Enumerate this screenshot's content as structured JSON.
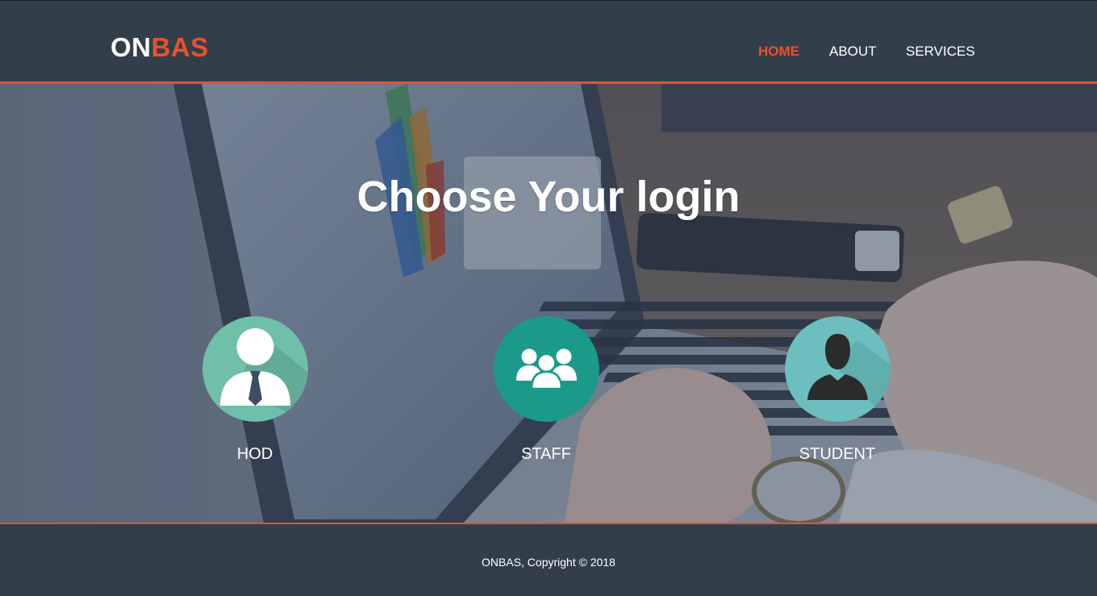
{
  "brand": {
    "part_a": "ON",
    "part_b": "BAS"
  },
  "nav": {
    "items": [
      {
        "label": "HOME",
        "active": true
      },
      {
        "label": "ABOUT",
        "active": false
      },
      {
        "label": "SERVICES",
        "active": false
      }
    ]
  },
  "hero": {
    "title": "Choose Your login",
    "roles": [
      {
        "label": "HOD",
        "icon": "hod-user-tie-icon"
      },
      {
        "label": "STAFF",
        "icon": "staff-group-icon"
      },
      {
        "label": "STUDENT",
        "icon": "student-silhouette-icon"
      }
    ]
  },
  "footer": {
    "text": "ONBAS, Copyright © 2018"
  },
  "colors": {
    "accent": "#e8512f",
    "navbar": "#323f4b",
    "hod_circle": "#6fbfa9",
    "staff_circle": "#1b9a8a",
    "student_circle": "#6cbfbe"
  }
}
